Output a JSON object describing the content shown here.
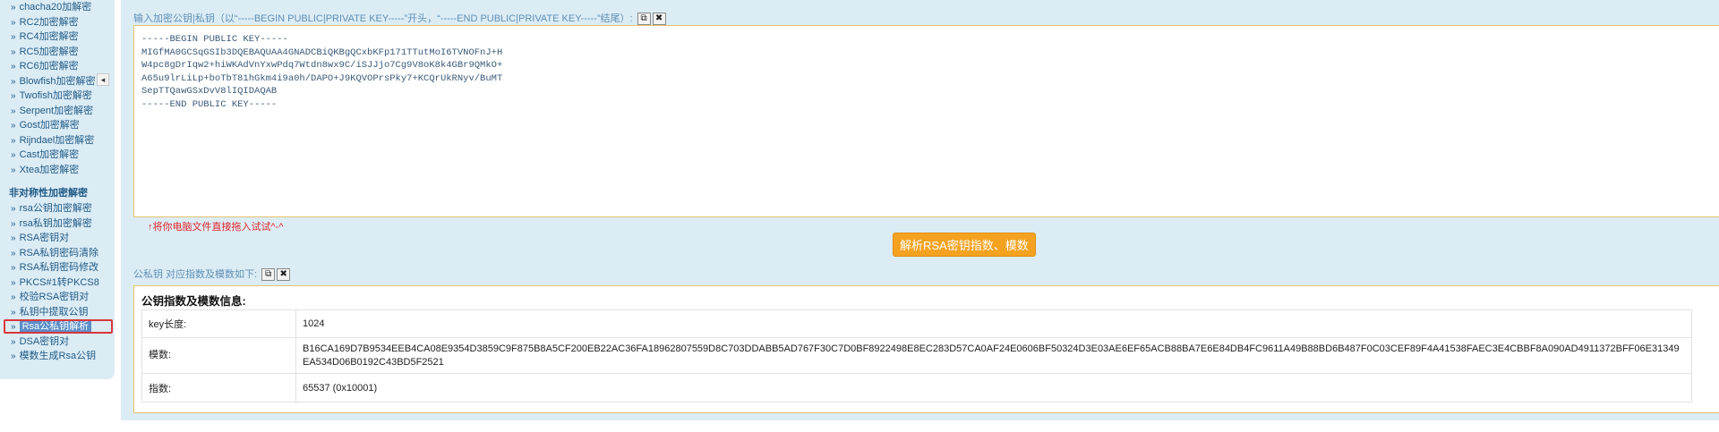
{
  "sidebar": {
    "items_top": [
      {
        "label": "chacha20加解密"
      },
      {
        "label": "RC2加密解密"
      },
      {
        "label": "RC4加密解密"
      },
      {
        "label": "RC5加密解密"
      },
      {
        "label": "RC6加密解密"
      },
      {
        "label": "Blowfish加密解密"
      },
      {
        "label": "Twofish加密解密"
      },
      {
        "label": "Serpent加密解密"
      },
      {
        "label": "Gost加密解密"
      },
      {
        "label": "Rijndael加密解密"
      },
      {
        "label": "Cast加密解密"
      },
      {
        "label": "Xtea加密解密"
      }
    ],
    "section_heading": "非对称性加密解密",
    "items_bottom": [
      {
        "label": "rsa公钥加密解密"
      },
      {
        "label": "rsa私钥加密解密"
      },
      {
        "label": "RSA密钥对"
      },
      {
        "label": "RSA私钥密码清除"
      },
      {
        "label": "RSA私钥密码修改"
      },
      {
        "label": "PKCS#1转PKCS8"
      },
      {
        "label": "校验RSA密钥对"
      },
      {
        "label": "私钥中提取公钥"
      },
      {
        "label": "Rsa公私钥解析"
      },
      {
        "label": "DSA密钥对"
      },
      {
        "label": "模数生成Rsa公钥"
      }
    ],
    "active_item": "Rsa公私钥解析",
    "collapse_icon": "◂"
  },
  "input_section": {
    "label": "输入加密公钥|私钥（以“-----BEGIN PUBLIC|PRIVATE KEY-----”开头，“-----END PUBLIC|PRIVATE KEY-----”结尾）:",
    "key_text": "-----BEGIN PUBLIC KEY-----\nMIGfMA0GCSqGSIb3DQEBAQUAA4GNADCBiQKBgQCxbKFp171TTutMoI6TVNOFnJ+H\nW4pc8gDrIqw2+hiWKAdVnYxwPdq7Wtdn8wx9C/iSJJjo7Cg9V8oK8k4GBr9QMkO+\nA65u9lrLiLp+boTbT81hGkm4i9a0h/DAPO+J9KQVOPrsPky7+KCQrUkRNyv/BuMT\nSepTTQawGSxDvV8lIQIDAQAB\n-----END PUBLIC KEY-----",
    "hint": "↑将你电脑文件直接拖入试试^-^",
    "copy_icon": "⧉",
    "clear_icon": "✖"
  },
  "parse_button": "解析RSA密钥指数、模数",
  "output_section": {
    "label": "公私钥 对应指数及模数如下:",
    "copy_icon": "⧉",
    "clear_icon": "✖",
    "title": "公钥指数及模数信息:",
    "rows": [
      {
        "key": "key长度:",
        "value": "1024"
      },
      {
        "key": "模数:",
        "value": "B16CA169D7B9534EEB4CA08E9354D3859C9F875B8A5CF200EB22AC36FA18962807559D8C703DDABB5AD767F30C7D0BF8922498E8EC283D57CA0AF24E0606BF50324D3E03AE6EF65ACB88BA7E6E84DB4FC9611A49B88BD6B487F0C03CEF89F4A41538FAEC3E4CBBF8A090AD4911372BFF06E31349EA534D06B0192C43BD5F2521"
      },
      {
        "key": "指数:",
        "value": "65537 (0x10001)"
      }
    ]
  },
  "colors": {
    "panel_bg": "#dcecf5",
    "accent_button": "#f4a21f",
    "link_blue": "#1f5a86",
    "hint_red": "#e0262a",
    "active_border": "#d9363e"
  }
}
